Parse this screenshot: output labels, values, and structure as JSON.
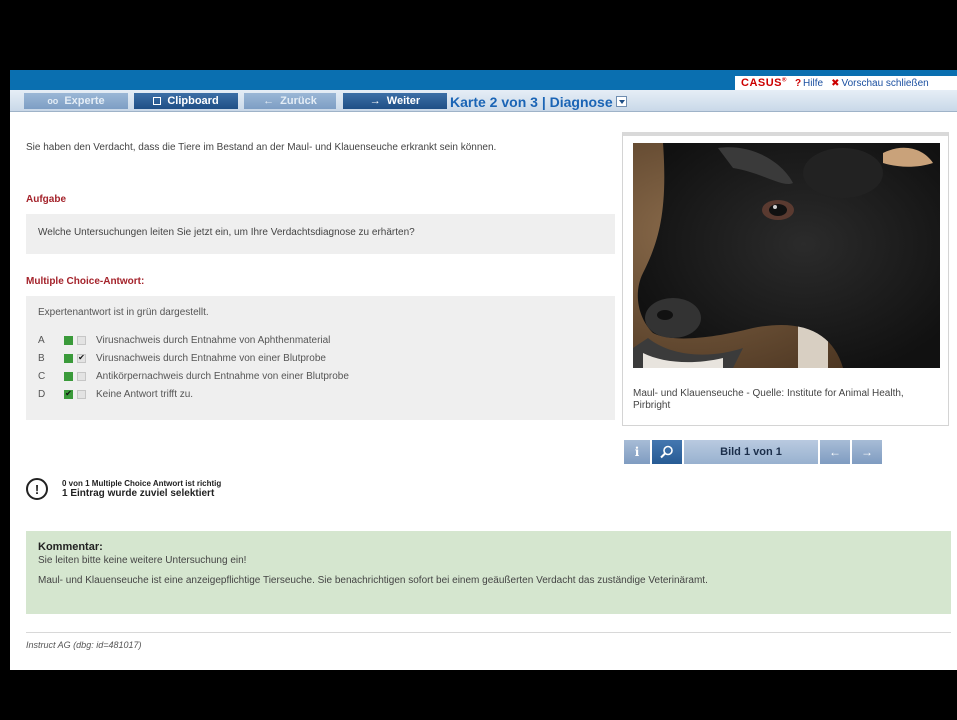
{
  "header": {
    "brand": "CASUS",
    "brand_mark": "®",
    "help_label": "Hilfe",
    "close_preview_label": "Vorschau schließen"
  },
  "navbar": {
    "expert_label": "Experte",
    "clipboard_label": "Clipboard",
    "back_label": "Zurück",
    "next_label": "Weiter",
    "card_select": "Karte 2 von 3 | Diagnose"
  },
  "main": {
    "intro": "Sie haben den Verdacht, dass die Tiere im Bestand an der Maul- und Klauenseuche erkrankt sein können.",
    "task_heading": "Aufgabe",
    "task_question": "Welche Untersuchungen leiten Sie jetzt ein, um Ihre Verdachtsdiagnose zu erhärten?",
    "mc_heading": "Multiple Choice-Antwort:",
    "mc_hint": "Expertenantwort ist in grün dargestellt.",
    "options": [
      {
        "letter": "A",
        "text": "Virusnachweis durch Entnahme von Aphthenmaterial",
        "expert": true,
        "user": false
      },
      {
        "letter": "B",
        "text": "Virusnachweis durch Entnahme von einer Blutprobe",
        "expert": true,
        "user": true
      },
      {
        "letter": "C",
        "text": "Antikörpernachweis durch Entnahme von einer Blutprobe",
        "expert": true,
        "user": false
      },
      {
        "letter": "D",
        "text": "Keine Antwort trifft zu.",
        "expert": false,
        "user": true
      }
    ]
  },
  "image_panel": {
    "caption": "Maul- und Klauenseuche - Quelle: Institute for Animal Health, Pirbright",
    "info_icon": "i",
    "counter": "Bild 1 von 1"
  },
  "result": {
    "line1": "0 von 1 Multiple Choice Antwort ist richtig",
    "line2": "1 Eintrag wurde zuviel selektiert"
  },
  "comment": {
    "title": "Kommentar:",
    "line1": "Sie leiten bitte keine weitere Untersuchung ein!",
    "line2": "Maul- und Klauenseuche ist eine anzeigepflichtige Tierseuche. Sie benachrichtigen sofort bei einem geäußerten Verdacht das zuständige Veterinäramt."
  },
  "footer": {
    "text": "Instruct AG (dbg: id=481017)"
  },
  "colors": {
    "topbar": "#0a6fb0",
    "accent_red": "#a4232b",
    "expert_green": "#3a9a3a",
    "comment_bg": "#d5e6cf"
  }
}
